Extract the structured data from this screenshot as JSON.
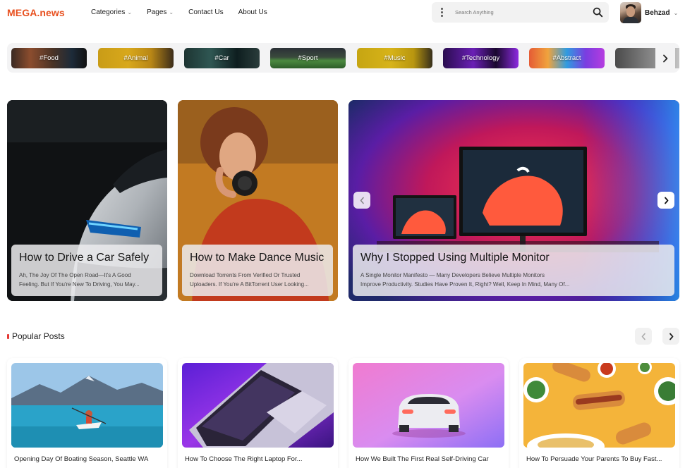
{
  "header": {
    "logo": "MEGA.news",
    "nav": [
      {
        "label": "Categories",
        "has_dropdown": true
      },
      {
        "label": "Pages",
        "has_dropdown": true
      },
      {
        "label": "Contact Us",
        "has_dropdown": false
      },
      {
        "label": "About Us",
        "has_dropdown": false
      }
    ],
    "search": {
      "placeholder": "Search Anything",
      "value": ""
    },
    "user": {
      "name": "Behzad"
    }
  },
  "tags": [
    {
      "label": "#Food"
    },
    {
      "label": "#Animal"
    },
    {
      "label": "#Car"
    },
    {
      "label": "#Sport"
    },
    {
      "label": "#Music"
    },
    {
      "label": "#Technology"
    },
    {
      "label": "#Abstract"
    }
  ],
  "hero": [
    {
      "title": "How to Drive a Car Safely",
      "excerpt_line1": "Ah, The Joy Of The Open Road—It's A Good",
      "excerpt_line2": "Feeling. But If You're New To Driving, You May..."
    },
    {
      "title": "How to Make Dance Music",
      "excerpt_line1": "Download Torrents From Verified Or Trusted",
      "excerpt_line2": "Uploaders. If You're A BitTorrent User Looking..."
    },
    {
      "title": "Why I Stopped Using Multiple Monitor",
      "excerpt_line1": "A Single Monitor Manifesto — Many Developers Believe Multiple Monitors",
      "excerpt_line2": "Improve Productivity. Studies Have Proven It, Right? Well, Keep In Mind, Many Of..."
    }
  ],
  "popular": {
    "heading": "Popular Posts",
    "accent_color": "#e53935",
    "posts": [
      {
        "title": "Opening Day Of Boating Season, Seattle WA"
      },
      {
        "title": "How To Choose The Right Laptop For..."
      },
      {
        "title": "How We Built The First Real Self-Driving Car"
      },
      {
        "title": "How To Persuade Your Parents To Buy Fast..."
      }
    ]
  },
  "colors": {
    "brand": "#e8501f",
    "search_bg": "#f2f2f2",
    "strip_bg": "#f3f3f4"
  }
}
